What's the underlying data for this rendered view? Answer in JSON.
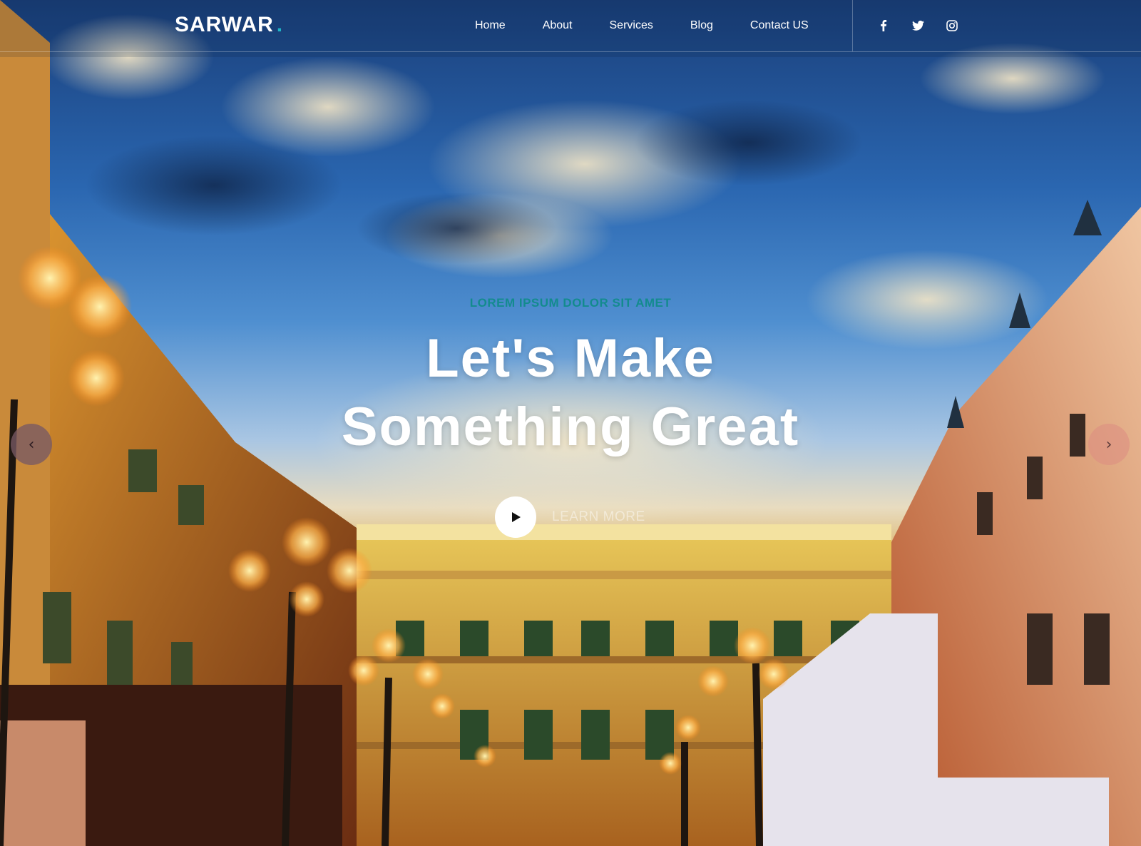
{
  "brand": {
    "name": "SARWAR",
    "dot": "."
  },
  "nav": {
    "items": [
      {
        "label": "Home"
      },
      {
        "label": "About"
      },
      {
        "label": "Services"
      },
      {
        "label": "Blog"
      },
      {
        "label": "Contact US"
      }
    ]
  },
  "social": {
    "icons": [
      "facebook-icon",
      "twitter-icon",
      "instagram-icon"
    ]
  },
  "hero": {
    "eyebrow": "LOREM IPSUM DOLOR SIT AMET",
    "headline_line1": "Let's Make",
    "headline_line2": "Something Great",
    "cta_label": "LEARN MORE"
  },
  "carousel": {
    "prev_symbol": "‹",
    "next_symbol": "›"
  },
  "colors": {
    "accent": "#1fb5c6",
    "eyebrow": "#138b8e",
    "text": "#ffffff"
  }
}
